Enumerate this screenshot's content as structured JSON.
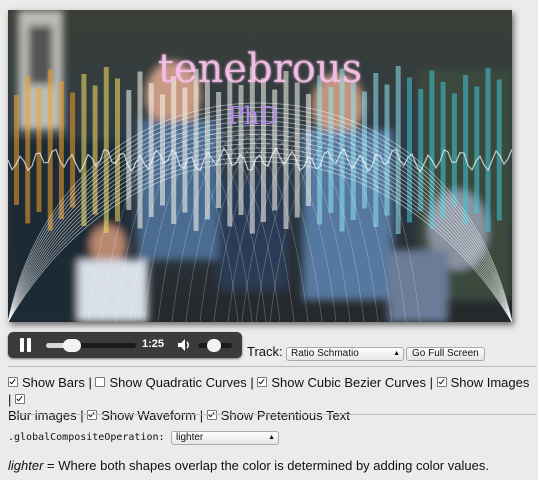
{
  "visualizer": {
    "title_text": "tenebrous",
    "subtitle_text": "PhD",
    "bar_colors": [
      "#f6a028",
      "#f7e060",
      "#fbfbf0",
      "#8fe3ef",
      "#3fc6d8"
    ]
  },
  "player": {
    "time": "1:25",
    "progress": 0.28,
    "volume": 0.4
  },
  "track": {
    "label": "Track:",
    "selected": "Ratio Schmatio",
    "fullscreen_label": "Go Full Screen"
  },
  "options": [
    {
      "label": "Show Bars",
      "checked": true
    },
    {
      "label": "Show Quadratic Curves",
      "checked": false
    },
    {
      "label": "Show Cubic Bezier Curves",
      "checked": true
    },
    {
      "label": "Show Images",
      "checked": true
    },
    {
      "label": "Blur images",
      "checked": true
    },
    {
      "label": "Show Waveform",
      "checked": true
    },
    {
      "label": "Show Pretentious Text",
      "checked": true
    }
  ],
  "composite": {
    "label": ".globalCompositeOperation:",
    "selected": "lighter",
    "desc_term": "lighter",
    "desc_text": " = Where both shapes overlap the color is determined by adding color values."
  }
}
